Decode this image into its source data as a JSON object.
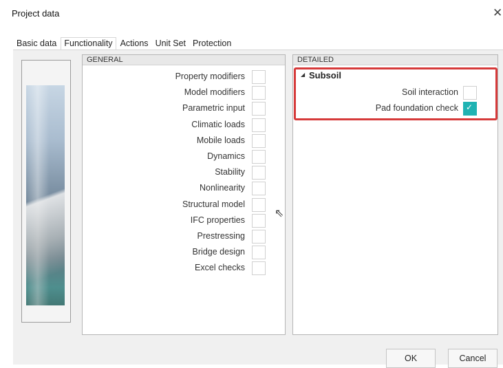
{
  "window": {
    "title": "Project data"
  },
  "tabs": [
    "Basic data",
    "Functionality",
    "Actions",
    "Unit Set",
    "Protection"
  ],
  "general": {
    "header": "GENERAL",
    "items": [
      {
        "label": "Property modifiers",
        "checked": false
      },
      {
        "label": "Model modifiers",
        "checked": false
      },
      {
        "label": "Parametric input",
        "checked": false
      },
      {
        "label": "Climatic loads",
        "checked": false
      },
      {
        "label": "Mobile loads",
        "checked": false
      },
      {
        "label": "Dynamics",
        "checked": false
      },
      {
        "label": "Stability",
        "checked": false
      },
      {
        "label": "Nonlinearity",
        "checked": false
      },
      {
        "label": "Structural model",
        "checked": false
      },
      {
        "label": "IFC properties",
        "checked": false
      },
      {
        "label": "Prestressing",
        "checked": false
      },
      {
        "label": "Bridge design",
        "checked": false
      },
      {
        "label": "Excel checks",
        "checked": false
      }
    ]
  },
  "detailed": {
    "header": "DETAILED",
    "group": "Subsoil",
    "items": [
      {
        "label": "Soil interaction",
        "checked": false
      },
      {
        "label": "Pad foundation check",
        "checked": true
      }
    ]
  },
  "buttons": {
    "ok": "OK",
    "cancel": "Cancel"
  },
  "colors": {
    "highlight": "#d63a3a",
    "checked": "#1fb3b3"
  }
}
